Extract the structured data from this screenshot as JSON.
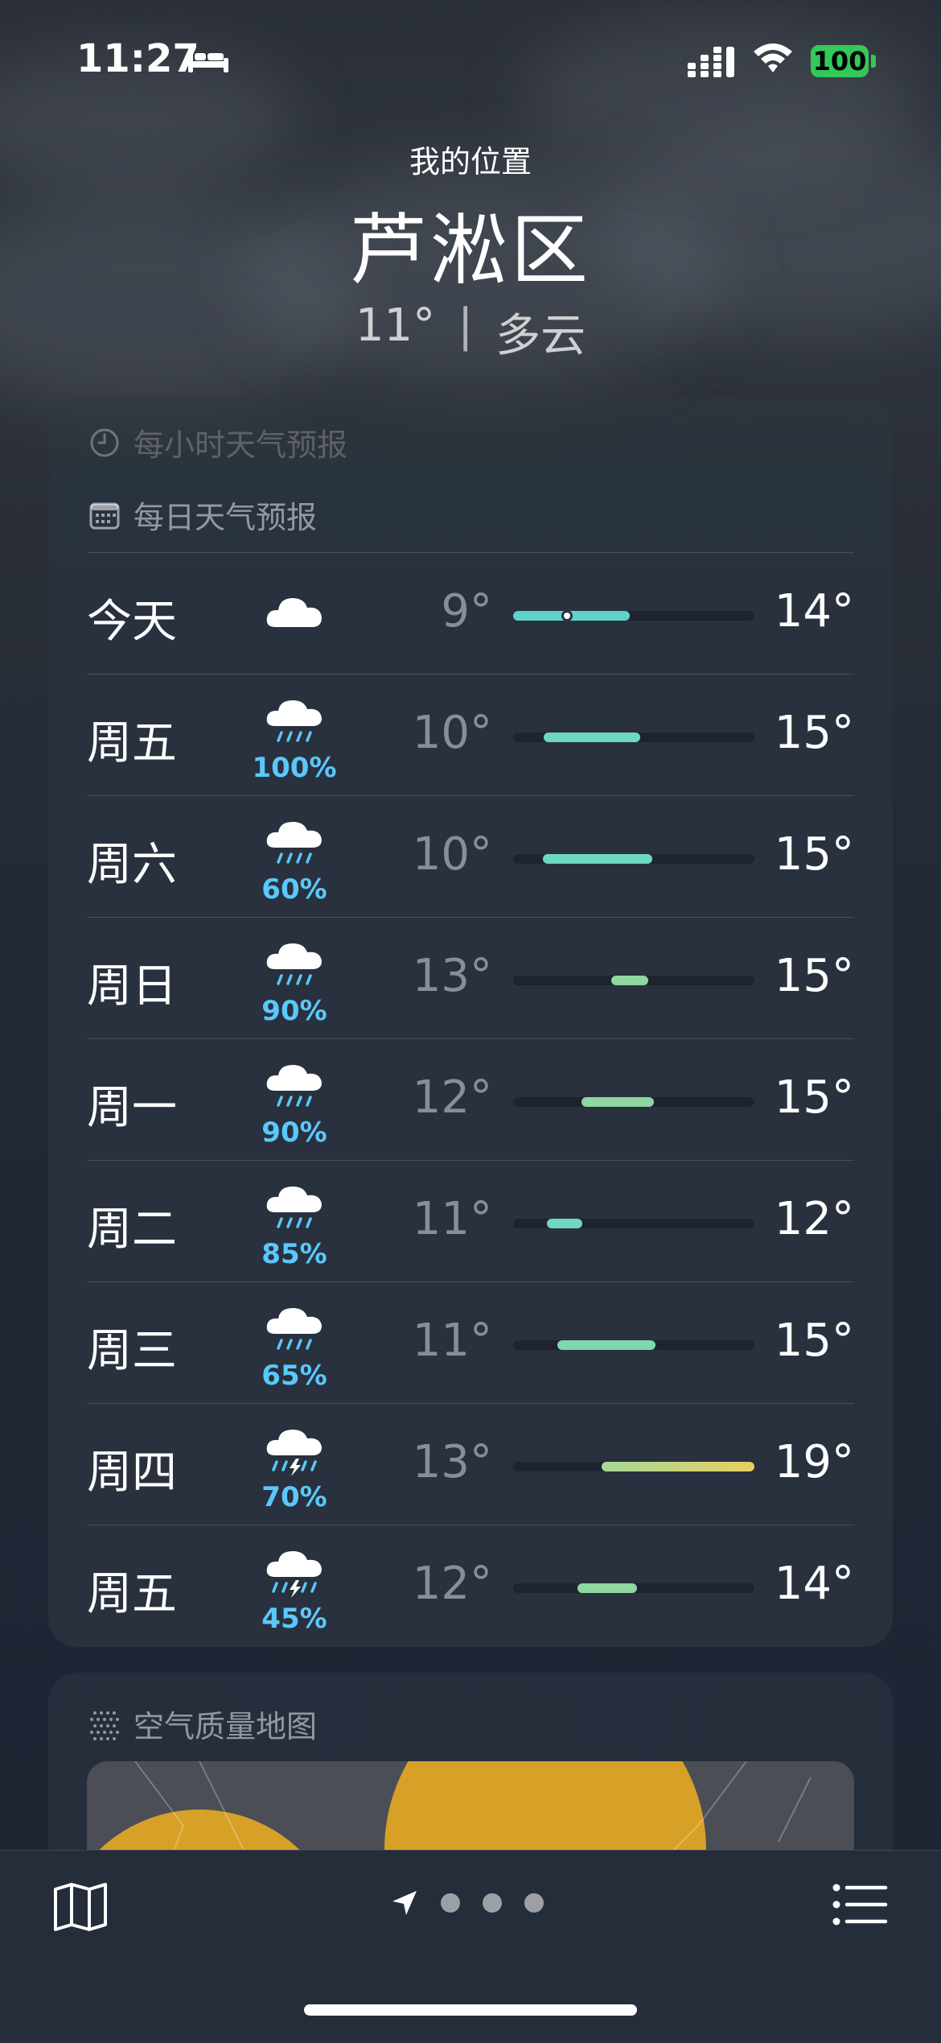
{
  "status_bar": {
    "time": "11:27",
    "battery": "100"
  },
  "header": {
    "location_label": "我的位置",
    "city": "芦淞区",
    "temperature": "11°",
    "separator": "|",
    "condition": "多云"
  },
  "hourly": {
    "title": "每小时天气预报"
  },
  "daily": {
    "title": "每日天气预报",
    "rows": [
      {
        "day": "今天",
        "icon": "cloud-icon",
        "precip": "",
        "low": "9°",
        "high": "14°",
        "bar_color": "#5fd3c7"
      },
      {
        "day": "周五",
        "icon": "rain-cloud-icon",
        "precip": "100%",
        "low": "10°",
        "high": "15°",
        "bar_color": "#6fd8c0"
      },
      {
        "day": "周六",
        "icon": "rain-cloud-icon",
        "precip": "60%",
        "low": "10°",
        "high": "15°",
        "bar_color": "#6fd8c0"
      },
      {
        "day": "周日",
        "icon": "rain-cloud-icon",
        "precip": "90%",
        "low": "13°",
        "high": "15°",
        "bar_color": "#8fd6a0"
      },
      {
        "day": "周一",
        "icon": "rain-cloud-icon",
        "precip": "90%",
        "low": "12°",
        "high": "15°",
        "bar_color": "#8fd6a0"
      },
      {
        "day": "周二",
        "icon": "rain-cloud-icon",
        "precip": "85%",
        "low": "11°",
        "high": "12°",
        "bar_color": "#6fd8c0"
      },
      {
        "day": "周三",
        "icon": "rain-cloud-icon",
        "precip": "65%",
        "low": "11°",
        "high": "15°",
        "bar_color": "#7fd6b0"
      },
      {
        "day": "周四",
        "icon": "thunderstorm-icon",
        "precip": "70%",
        "low": "13°",
        "high": "19°",
        "bar_color": "#d9d36a"
      },
      {
        "day": "周五",
        "icon": "thunderstorm-icon",
        "precip": "45%",
        "low": "12°",
        "high": "14°",
        "bar_color": "#8fd6a0"
      }
    ]
  },
  "air_quality": {
    "title": "空气质量地图"
  }
}
